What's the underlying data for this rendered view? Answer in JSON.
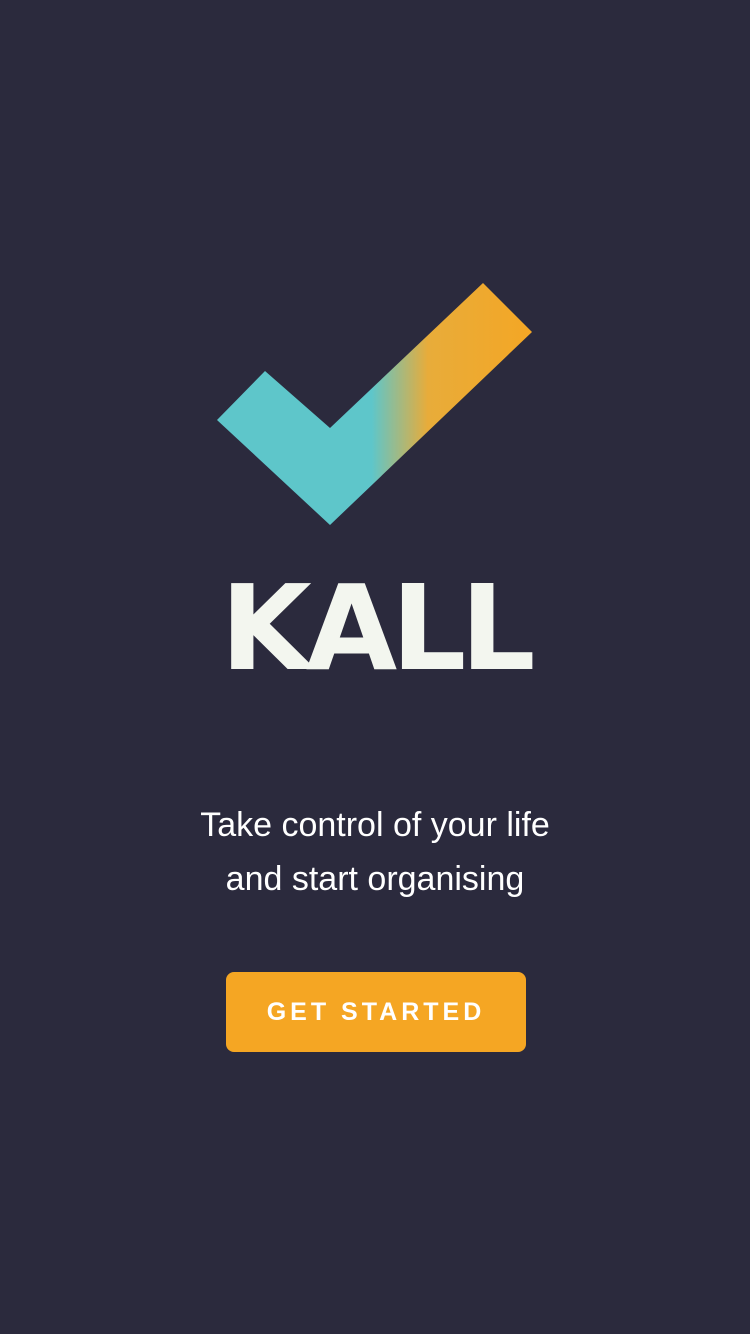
{
  "splash": {
    "logo_icon": "checkmark-icon",
    "brand_name": "KALL",
    "tagline_lines": [
      "Take control of your life",
      "and start organising"
    ],
    "cta_label": "GET STARTED"
  },
  "colors": {
    "background": "#2b2a3d",
    "logo_gradient_start": "#5ec6ca",
    "logo_gradient_end": "#f5a623",
    "brand_text": "#f3f6ef",
    "tagline_text": "#ffffff",
    "button_background": "#f5a623",
    "button_text": "#ffffff"
  }
}
